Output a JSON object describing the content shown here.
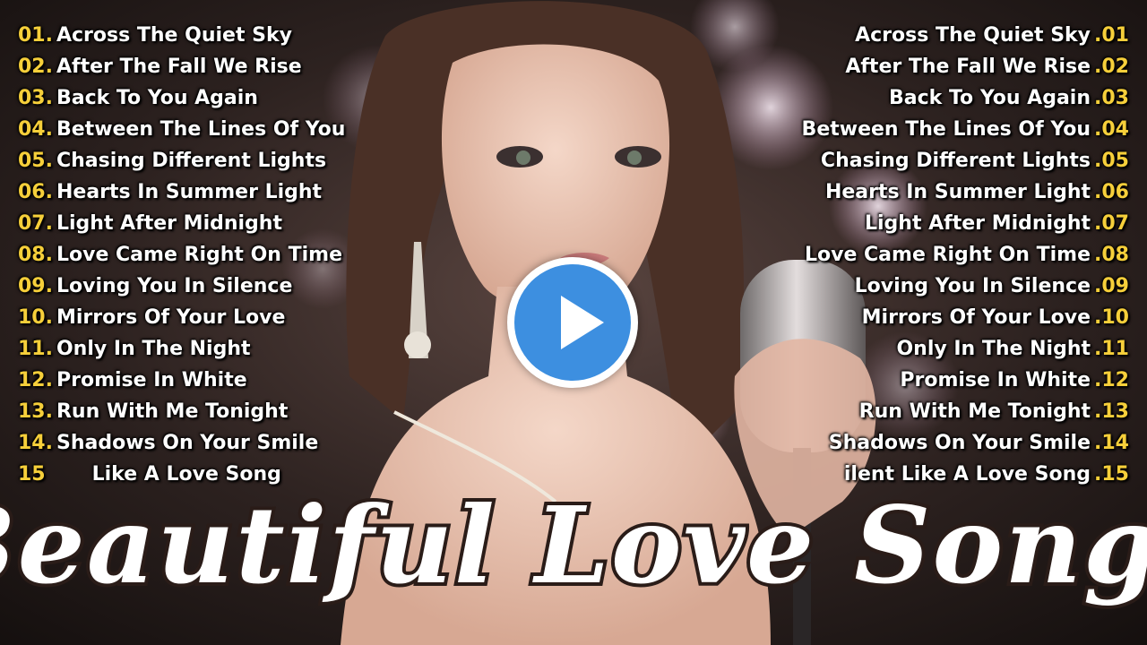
{
  "video": {
    "title": "Beautiful Love Songs",
    "play_label": "Play"
  },
  "colors": {
    "number": "#f6cf3a",
    "text": "#ffffff",
    "play_blue": "#3d8fe0"
  },
  "tracks_left": [
    {
      "num": "01.",
      "title": "Across The Quiet Sky"
    },
    {
      "num": "02.",
      "title": "After The Fall We Rise"
    },
    {
      "num": "03.",
      "title": "Back To You Again"
    },
    {
      "num": "04.",
      "title": "Between The Lines Of You"
    },
    {
      "num": "05.",
      "title": "Chasing Different Lights"
    },
    {
      "num": "06.",
      "title": "Hearts In Summer Light"
    },
    {
      "num": "07.",
      "title": "Light After Midnight"
    },
    {
      "num": "08.",
      "title": "Love Came Right On Time"
    },
    {
      "num": "09.",
      "title": "Loving You In Silence"
    },
    {
      "num": "10.",
      "title": "Mirrors Of Your Love"
    },
    {
      "num": "11.",
      "title": "Only In The Night"
    },
    {
      "num": "12.",
      "title": "Promise In White"
    },
    {
      "num": "13.",
      "title": "Run With Me Tonight"
    },
    {
      "num": "14.",
      "title": "Shadows On Your Smile"
    },
    {
      "num": "15",
      "title": "Like A Love Song"
    }
  ],
  "tracks_right": [
    {
      "num": ".01",
      "title": "Across The Quiet Sky"
    },
    {
      "num": ".02",
      "title": "After The Fall We Rise"
    },
    {
      "num": ".03",
      "title": "Back To You Again"
    },
    {
      "num": ".04",
      "title": "Between The Lines Of You"
    },
    {
      "num": ".05",
      "title": "Chasing Different Lights"
    },
    {
      "num": ".06",
      "title": "Hearts In Summer Light"
    },
    {
      "num": ".07",
      "title": "Light After Midnight"
    },
    {
      "num": ".08",
      "title": "Love Came Right On Time"
    },
    {
      "num": ".09",
      "title": "Loving You In Silence"
    },
    {
      "num": ".10",
      "title": "Mirrors Of Your Love"
    },
    {
      "num": ".11",
      "title": "Only In The Night"
    },
    {
      "num": ".12",
      "title": "Promise In White"
    },
    {
      "num": ".13",
      "title": "Run With Me Tonight"
    },
    {
      "num": ".14",
      "title": "Shadows On Your Smile"
    },
    {
      "num": ".15",
      "title": "ilent Like A Love Song"
    }
  ]
}
